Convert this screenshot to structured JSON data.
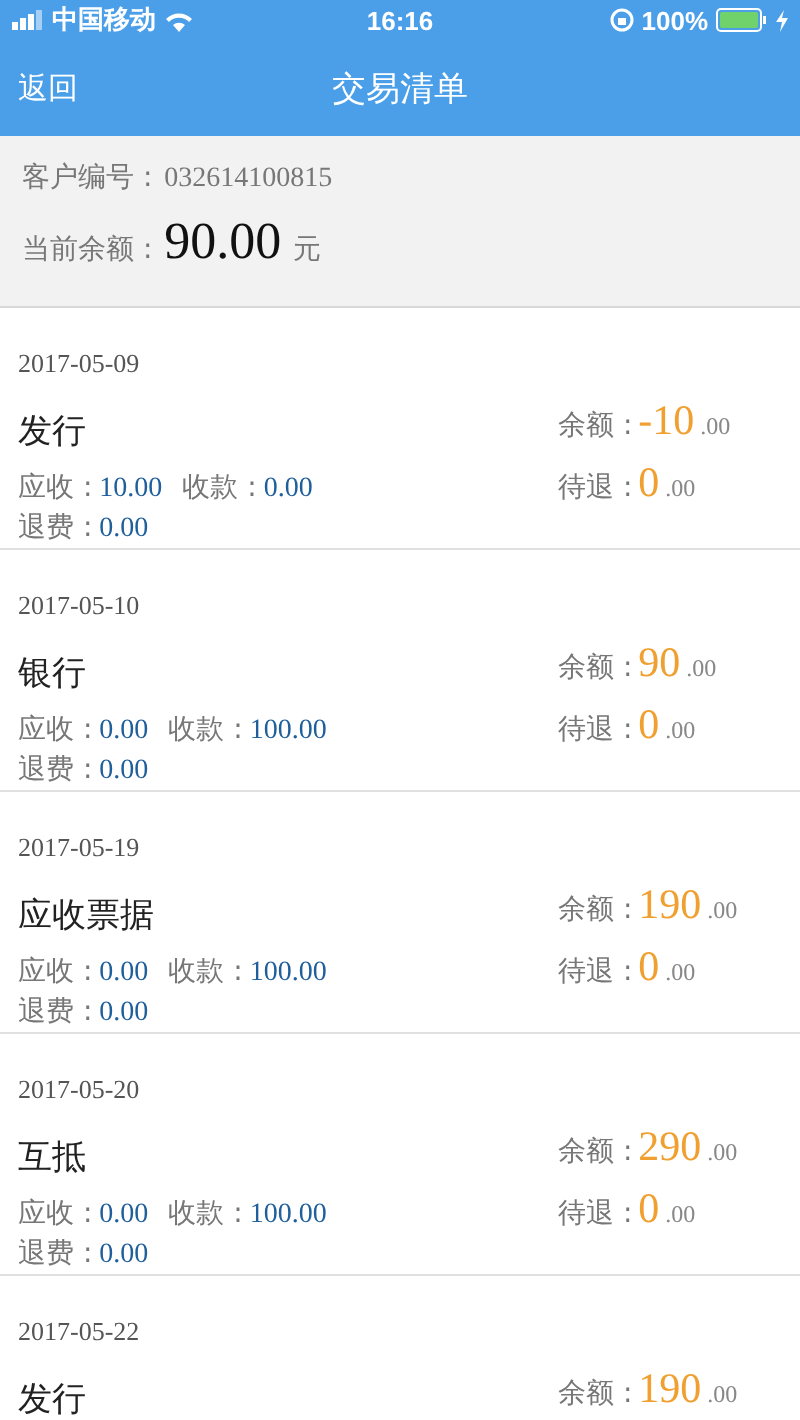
{
  "status_bar": {
    "carrier": "中国移动",
    "time": "16:16",
    "battery": "100%"
  },
  "nav": {
    "back": "返回",
    "title": "交易清单"
  },
  "account": {
    "id_label": "客户编号 :",
    "id": "032614100815",
    "balance_label": "当前余额 :",
    "balance": "90.00",
    "unit": "元"
  },
  "transactions": [
    {
      "date": "2017-05-09",
      "type": "发行",
      "receivable_label": "应收 :",
      "receivable": "10.00",
      "received_label": "收款 :",
      "received": "0.00",
      "refund_fee_label": "退费 :",
      "refund_fee": "0.00",
      "balance_label": "余额 :",
      "balance_int": "-10",
      "balance_dec": ".00",
      "pending_label": "待退 :",
      "pending_int": "0",
      "pending_dec": ".00"
    },
    {
      "date": "2017-05-10",
      "type": "银行",
      "receivable_label": "应收 :",
      "receivable": "0.00",
      "received_label": "收款 :",
      "received": "100.00",
      "refund_fee_label": "退费 :",
      "refund_fee": "0.00",
      "balance_label": "余额 :",
      "balance_int": "90",
      "balance_dec": ".00",
      "pending_label": "待退 :",
      "pending_int": "0",
      "pending_dec": ".00"
    },
    {
      "date": "2017-05-19",
      "type": "应收票据",
      "receivable_label": "应收 :",
      "receivable": "0.00",
      "received_label": "收款 :",
      "received": "100.00",
      "refund_fee_label": "退费 :",
      "refund_fee": "0.00",
      "balance_label": "余额 :",
      "balance_int": "190",
      "balance_dec": ".00",
      "pending_label": "待退 :",
      "pending_int": "0",
      "pending_dec": ".00"
    },
    {
      "date": "2017-05-20",
      "type": "互抵",
      "receivable_label": "应收 :",
      "receivable": "0.00",
      "received_label": "收款 :",
      "received": "100.00",
      "refund_fee_label": "退费 :",
      "refund_fee": "0.00",
      "balance_label": "余额 :",
      "balance_int": "290",
      "balance_dec": ".00",
      "pending_label": "待退 :",
      "pending_int": "0",
      "pending_dec": ".00"
    },
    {
      "date": "2017-05-22",
      "type": "发行",
      "balance_label": "余额 :",
      "balance_int": "190",
      "balance_dec": ".00"
    }
  ]
}
